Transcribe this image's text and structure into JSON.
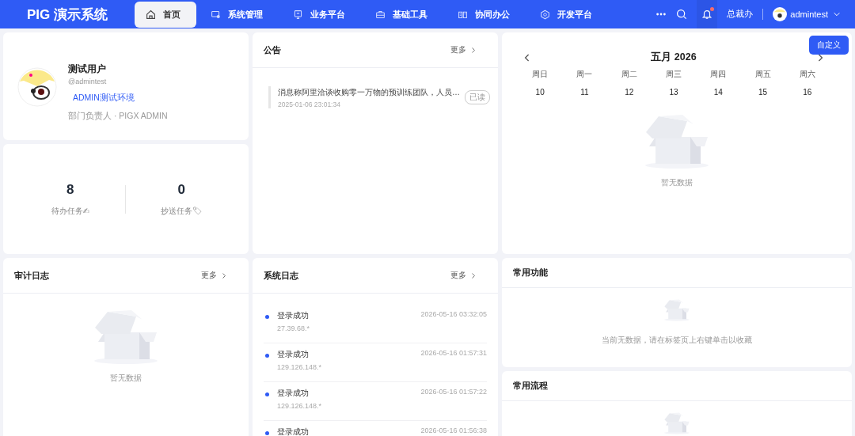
{
  "header": {
    "logo": "PIG 演示系统",
    "nav": [
      {
        "label": "首页",
        "selected": true
      },
      {
        "label": "系统管理",
        "selected": false
      },
      {
        "label": "业务平台",
        "selected": false
      },
      {
        "label": "基础工具",
        "selected": false
      },
      {
        "label": "协同办公",
        "selected": false
      },
      {
        "label": "开发平台",
        "selected": false
      }
    ],
    "notification_dot": true,
    "department": "总裁办",
    "username": "admintest"
  },
  "profile": {
    "name": "测试用户",
    "handle": "@admintest",
    "tag": "ADMIN测试环境",
    "role": "部门负责人 · PIGX ADMIN"
  },
  "tasks": [
    {
      "count": "8",
      "label": "待办任务✍"
    },
    {
      "count": "0",
      "label": "抄送任务🏷"
    }
  ],
  "notice": {
    "title": "公告",
    "more": "更多",
    "items": [
      {
        "text": "消息称阿里洽谈收购零一万物的预训练团队，人员…",
        "time": "2025-01-06 23:01:34",
        "badge": "已读"
      }
    ]
  },
  "calendar": {
    "customize": "自定义",
    "month": "五月 2026",
    "weekdays": [
      "周日",
      "周一",
      "周二",
      "周三",
      "周四",
      "周五",
      "周六"
    ],
    "days": [
      "10",
      "11",
      "12",
      "13",
      "14",
      "15",
      "16"
    ],
    "empty": "暂无数据"
  },
  "audit_log": {
    "title": "审计日志",
    "more": "更多",
    "empty": "暂无数据"
  },
  "system_log": {
    "title": "系统日志",
    "more": "更多",
    "items": [
      {
        "event": "登录成功",
        "ip": "27.39.68.*",
        "time": "2026-05-16 03:32:05"
      },
      {
        "event": "登录成功",
        "ip": "129.126.148.*",
        "time": "2026-05-16 01:57:31"
      },
      {
        "event": "登录成功",
        "ip": "129.126.148.*",
        "time": "2026-05-16 01:57:22"
      },
      {
        "event": "登录成功",
        "time": "2026-05-16 01:56:38"
      }
    ]
  },
  "favorites": {
    "title": "常用功能",
    "empty": "当前无数据，请在标签页上右键单击以收藏"
  },
  "flows": {
    "title": "常用流程"
  }
}
